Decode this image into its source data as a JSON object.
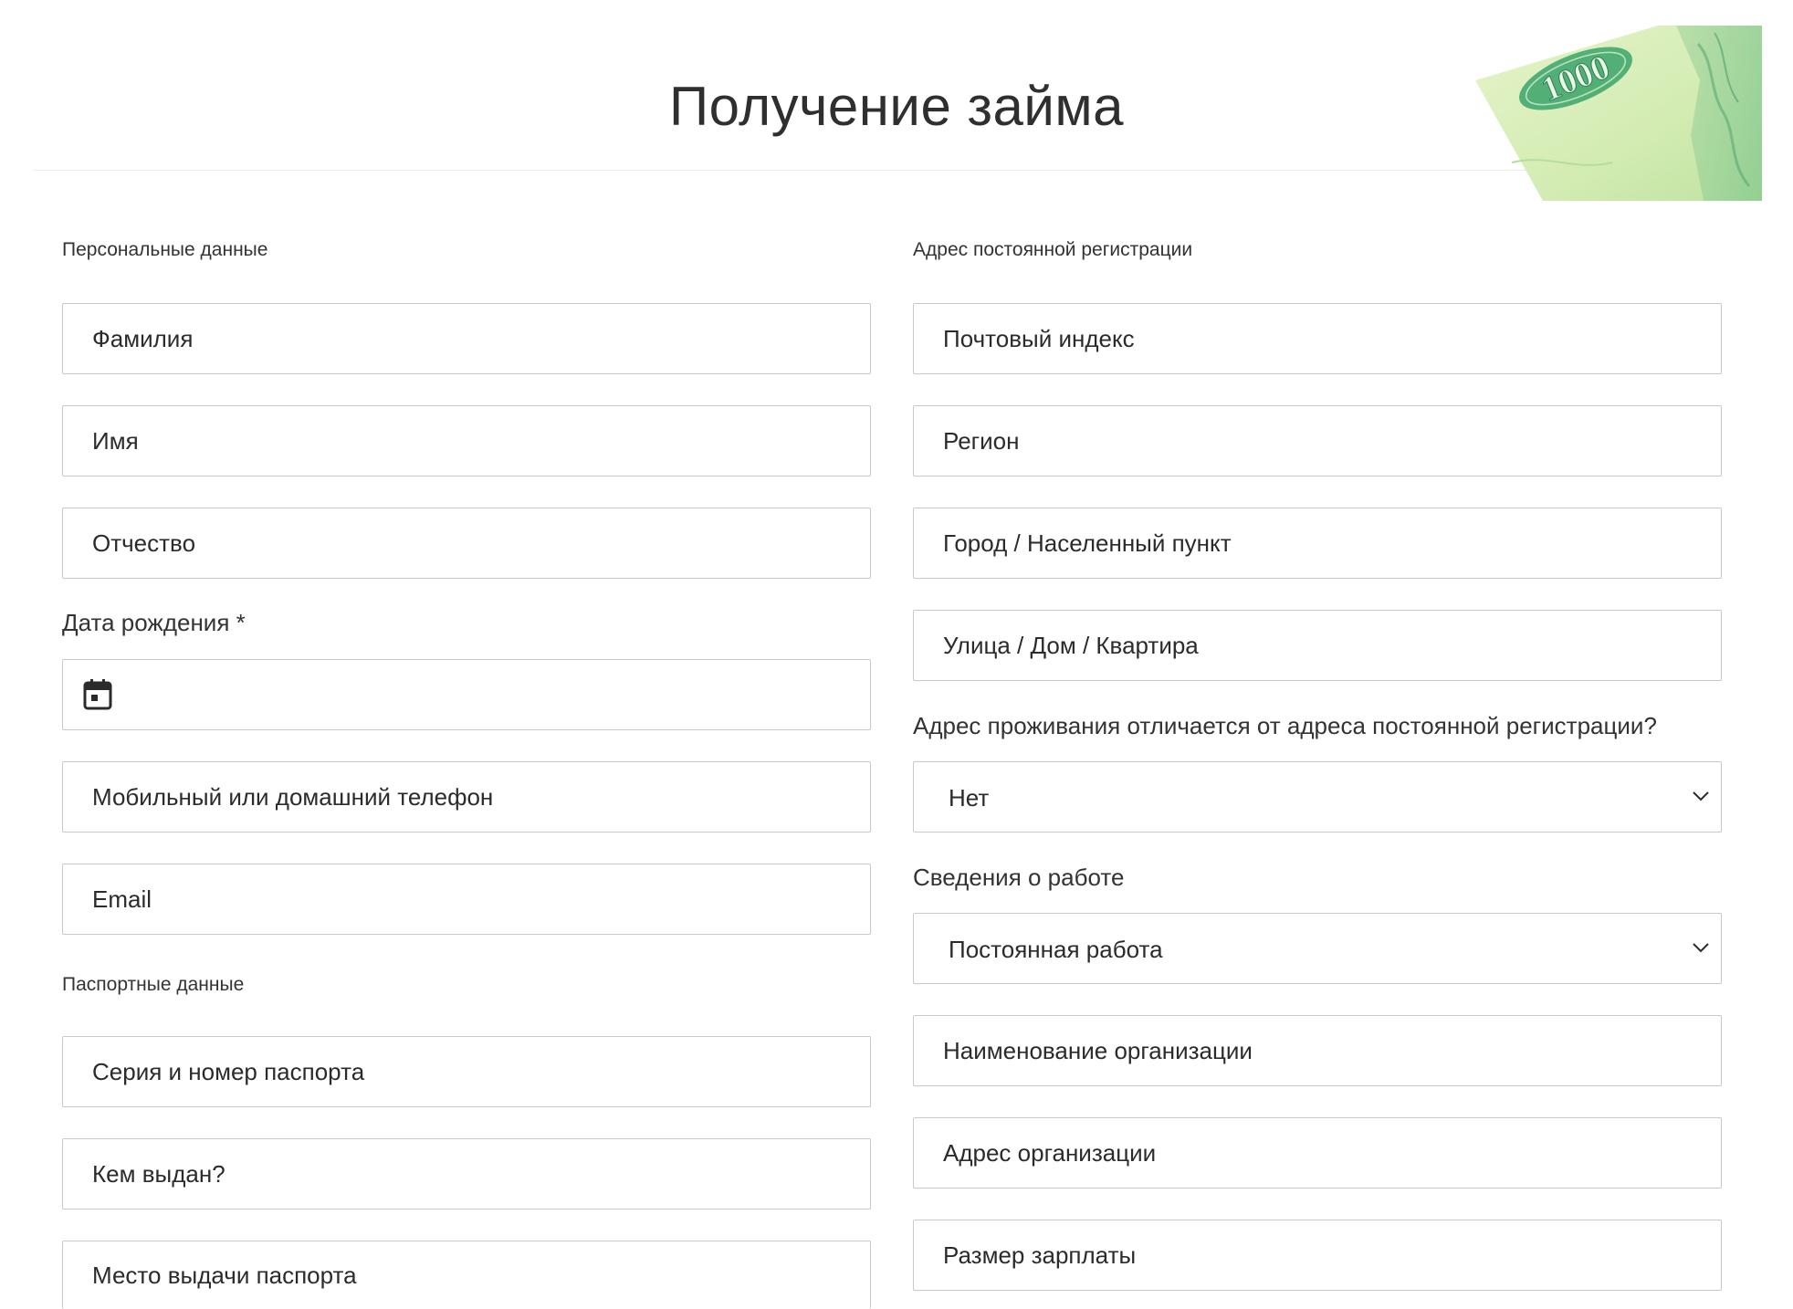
{
  "header": {
    "title": "Получение займа",
    "banknote_text": "1000"
  },
  "personal": {
    "section_title": "Персональные данные",
    "last_name_placeholder": "Фамилия",
    "first_name_placeholder": "Имя",
    "patronymic_placeholder": "Отчество",
    "birth_date_label": "Дата рождения *",
    "phone_placeholder": "Мобильный или домашний телефон",
    "email_placeholder": "Email"
  },
  "passport": {
    "section_title": "Паспортные данные",
    "series_number_placeholder": "Серия и номер паспорта",
    "issued_by_placeholder": "Кем выдан?",
    "issue_place_placeholder": "Место выдачи паспорта"
  },
  "registration": {
    "section_title": "Адрес постоянной регистрации",
    "postal_code_placeholder": "Почтовый индекс",
    "region_placeholder": "Регион",
    "city_placeholder": "Город / Населенный пункт",
    "street_placeholder": "Улица / Дом / Квартира",
    "residence_differs_label": "Адрес проживания отличается от адреса постоянной регистрации?",
    "residence_differs_value": "Нет"
  },
  "work": {
    "label": "Сведения о работе",
    "employment_value": "Постоянная работа",
    "org_name_placeholder": "Наименование организации",
    "org_address_placeholder": "Адрес организации",
    "salary_placeholder": "Размер зарплаты"
  },
  "colors": {
    "border": "#c8c8c8",
    "text": "#2b2b2b",
    "banknote_green": "#3aa36a"
  },
  "icons": {
    "calendar": "calendar-icon",
    "chevron": "chevron-down-icon"
  }
}
